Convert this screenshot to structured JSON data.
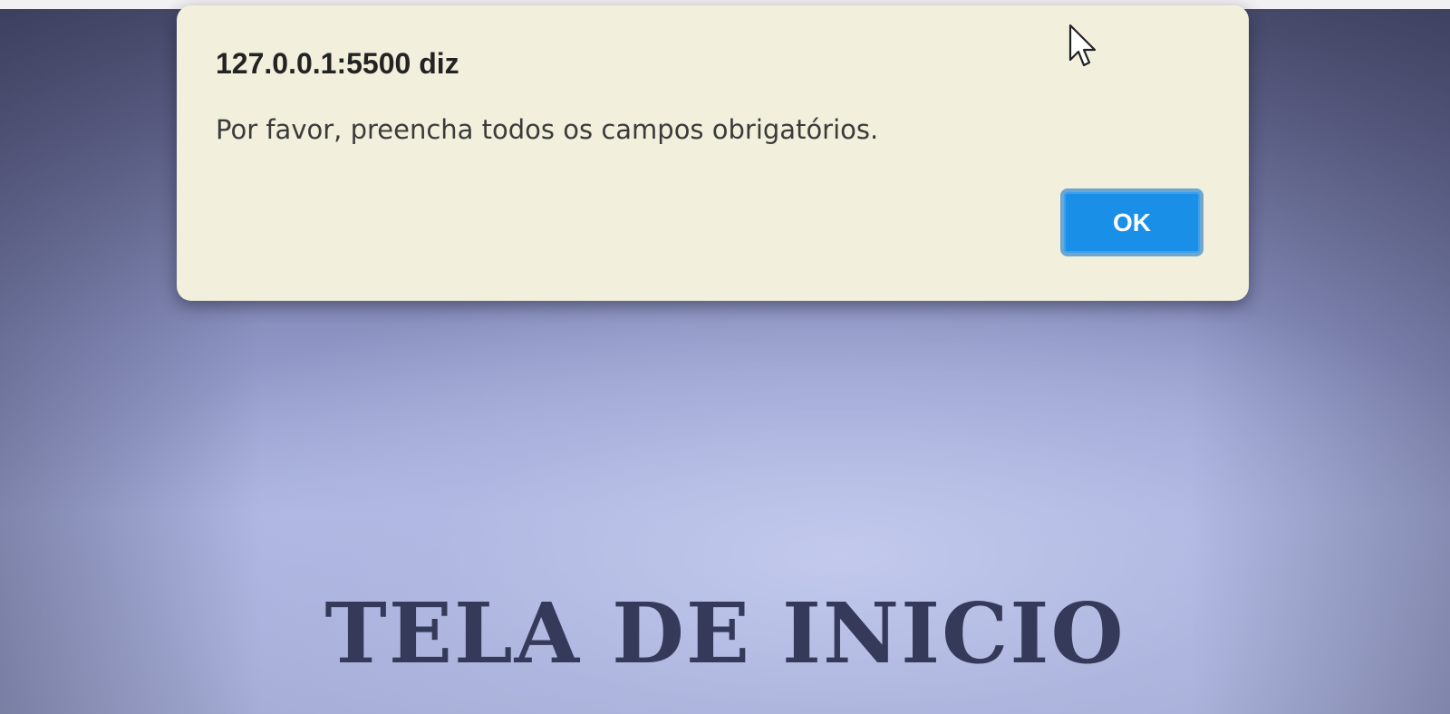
{
  "alert": {
    "title": "127.0.0.1:5500 diz",
    "message": "Por favor, preencha todos os campos obrigatórios.",
    "ok_label": "OK"
  },
  "page": {
    "heading": "TELA DE INICIO"
  },
  "icons": {
    "cursor": "mouse-pointer-icon"
  },
  "colors": {
    "dialog_background": "#f2f0dc",
    "ok_button": "#1a8fe8",
    "heading_text": "#363a5a"
  }
}
